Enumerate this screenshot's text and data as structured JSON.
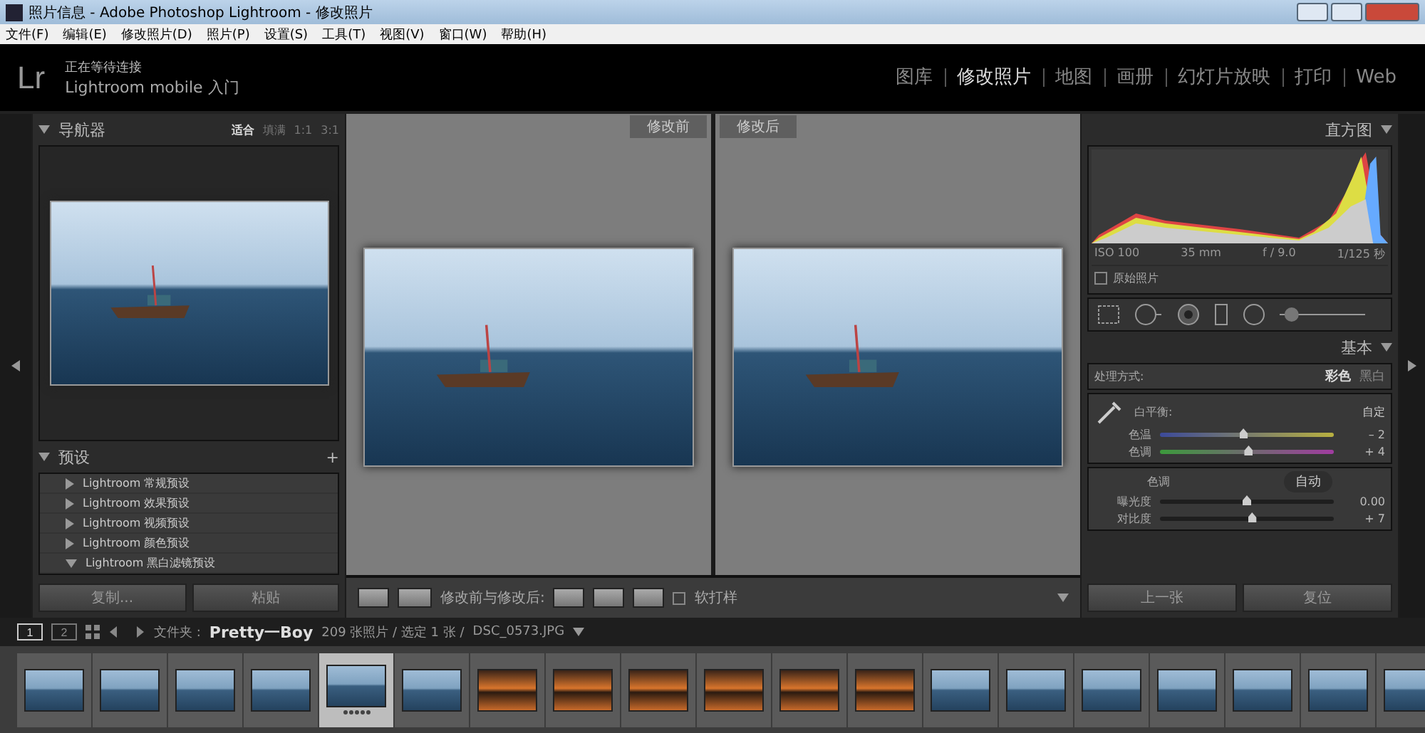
{
  "window": {
    "title": "照片信息 - Adobe Photoshop Lightroom - 修改照片"
  },
  "menu": [
    "文件(F)",
    "编辑(E)",
    "修改照片(D)",
    "照片(P)",
    "设置(S)",
    "工具(T)",
    "视图(V)",
    "窗口(W)",
    "帮助(H)"
  ],
  "header": {
    "logo": "Lr",
    "status": "正在等待连接",
    "mobile": "Lightroom mobile 入门",
    "modules": [
      {
        "label": "图库",
        "selected": false
      },
      {
        "label": "修改照片",
        "selected": true
      },
      {
        "label": "地图",
        "selected": false
      },
      {
        "label": "画册",
        "selected": false
      },
      {
        "label": "幻灯片放映",
        "selected": false
      },
      {
        "label": "打印",
        "selected": false
      },
      {
        "label": "Web",
        "selected": false
      }
    ]
  },
  "navigator": {
    "title": "导航器",
    "zoom": [
      {
        "label": "适合",
        "selected": true
      },
      {
        "label": "填满",
        "selected": false
      },
      {
        "label": "1:1",
        "selected": false
      },
      {
        "label": "3:1",
        "selected": false
      }
    ]
  },
  "presets": {
    "title": "预设",
    "add": "+",
    "items": [
      {
        "label": "Lightroom 常规预设",
        "expanded": false
      },
      {
        "label": "Lightroom 效果预设",
        "expanded": false
      },
      {
        "label": "Lightroom 视频预设",
        "expanded": false
      },
      {
        "label": "Lightroom 颜色预设",
        "expanded": false
      },
      {
        "label": "Lightroom 黑白滤镜预设",
        "expanded": true
      }
    ]
  },
  "left_buttons": [
    "复制...",
    "粘贴"
  ],
  "compare": {
    "before": "修改前",
    "after": "修改后"
  },
  "toolbar": {
    "mode_label": "修改前与修改后:",
    "soft_proof": {
      "label": "软打样",
      "checked": false
    }
  },
  "histogram": {
    "title": "直方图",
    "info": [
      "ISO 100",
      "35 mm",
      "f / 9.0",
      "1/125 秒"
    ],
    "original": {
      "label": "原始照片",
      "checked": false
    }
  },
  "tools": {
    "brush": {
      "level": 0.05
    }
  },
  "basic": {
    "title": "基本",
    "treatment_label": "处理方式:",
    "treatments": [
      {
        "label": "彩色",
        "selected": true
      },
      {
        "label": "黑白",
        "selected": false
      }
    ],
    "wb_label": "白平衡:",
    "wb_value": "自定",
    "tone_label": "色调",
    "auto": "自动",
    "sliders": [
      {
        "label": "色温",
        "kind": "temp",
        "level": 0.48,
        "reading": "– 2"
      },
      {
        "label": "色调",
        "kind": "tint",
        "level": 0.51,
        "reading": "+ 4"
      },
      {
        "label": "曝光度",
        "kind": "plain",
        "level": 0.5,
        "reading": "0.00"
      },
      {
        "label": "对比度",
        "kind": "plain",
        "level": 0.53,
        "reading": "+ 7"
      }
    ]
  },
  "right_buttons": [
    "上一张",
    "复位"
  ],
  "filmbar": {
    "pages": [
      {
        "label": "1",
        "selected": true
      },
      {
        "label": "2",
        "selected": false
      }
    ],
    "folder_label": "文件夹 :",
    "folder": "Pretty一Boy",
    "count": "209 张照片 / 选定 1 张 /",
    "file": "DSC_0573.JPG"
  },
  "filmstrip": [
    {
      "kind": "day",
      "selected": false
    },
    {
      "kind": "day",
      "selected": false
    },
    {
      "kind": "day",
      "selected": false
    },
    {
      "kind": "day",
      "selected": false
    },
    {
      "kind": "day",
      "selected": true,
      "stars": 5
    },
    {
      "kind": "day",
      "selected": false
    },
    {
      "kind": "sunset",
      "selected": false
    },
    {
      "kind": "sunset",
      "selected": false
    },
    {
      "kind": "sunset",
      "selected": false
    },
    {
      "kind": "sunset",
      "selected": false
    },
    {
      "kind": "sunset",
      "selected": false
    },
    {
      "kind": "sunset",
      "selected": false
    },
    {
      "kind": "day",
      "selected": false
    },
    {
      "kind": "day",
      "selected": false
    },
    {
      "kind": "day",
      "selected": false
    },
    {
      "kind": "day",
      "selected": false
    },
    {
      "kind": "day",
      "selected": false
    },
    {
      "kind": "day",
      "selected": false
    },
    {
      "kind": "day",
      "selected": false
    }
  ]
}
